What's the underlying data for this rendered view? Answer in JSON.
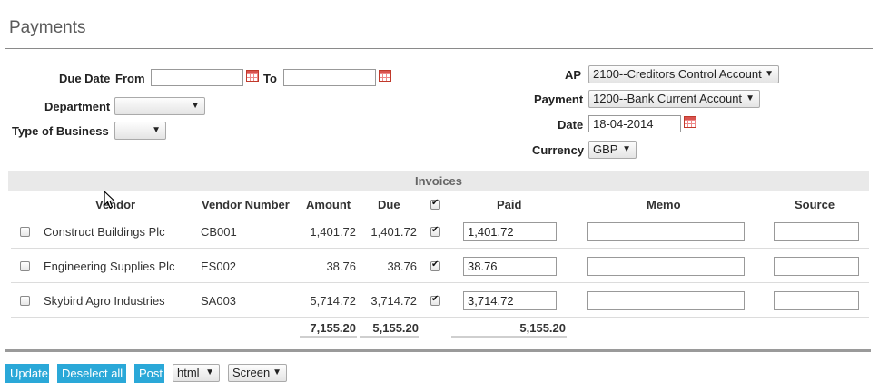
{
  "page": {
    "title": "Payments"
  },
  "filters": {
    "due_date_label": "Due Date",
    "from_label": "From",
    "from_value": "",
    "to_label": "To",
    "to_value": "",
    "department_label": "Department",
    "department_value": "",
    "type_of_business_label": "Type of Business",
    "type_of_business_value": "",
    "ap_label": "AP",
    "ap_value": "2100--Creditors Control Account",
    "payment_label": "Payment",
    "payment_value": "1200--Bank Current Account",
    "date_label": "Date",
    "date_value": "18-04-2014",
    "currency_label": "Currency",
    "currency_value": "GBP"
  },
  "invoices": {
    "section_title": "Invoices",
    "columns": {
      "vendor": "Vendor",
      "vendor_number": "Vendor Number",
      "amount": "Amount",
      "due": "Due",
      "paid": "Paid",
      "memo": "Memo",
      "source": "Source"
    },
    "header_checkbox_checked": true,
    "rows": [
      {
        "selected": false,
        "vendor": "Construct Buildings Plc",
        "vendor_number": "CB001",
        "amount": "1,401.72",
        "due": "1,401.72",
        "pay": true,
        "paid": "1,401.72",
        "memo": "",
        "source": ""
      },
      {
        "selected": false,
        "vendor": "Engineering Supplies Plc",
        "vendor_number": "ES002",
        "amount": "38.76",
        "due": "38.76",
        "pay": true,
        "paid": "38.76",
        "memo": "",
        "source": ""
      },
      {
        "selected": false,
        "vendor": "Skybird Agro Industries",
        "vendor_number": "SA003",
        "amount": "5,714.72",
        "due": "3,714.72",
        "pay": true,
        "paid": "3,714.72",
        "memo": "",
        "source": ""
      }
    ],
    "totals": {
      "amount": "7,155.20",
      "due": "5,155.20",
      "paid": "5,155.20"
    }
  },
  "actions": {
    "update_label": "Update",
    "deselect_all_label": "Deselect all",
    "post_label": "Post",
    "format_value": "html",
    "output_value": "Screen"
  },
  "colors": {
    "accent": "#2aa8d8",
    "header_bg": "#e9e9e9",
    "calendar": "#d9534f"
  },
  "icons": {
    "calendar": "calendar-icon",
    "dropdown": "chevron-down-icon",
    "cursor": "mouse-pointer-icon"
  }
}
